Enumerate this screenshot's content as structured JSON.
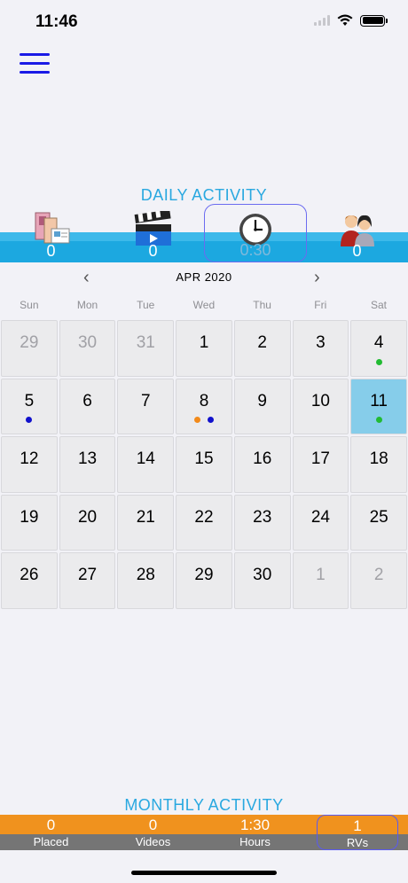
{
  "status": {
    "time": "11:46"
  },
  "daily": {
    "title": "DAILY ACTIVITY",
    "items": [
      {
        "value": "0",
        "icon": "magazines-icon"
      },
      {
        "value": "0",
        "icon": "video-clapper-icon"
      },
      {
        "value": "0:30",
        "icon": "clock-icon"
      },
      {
        "value": "0",
        "icon": "people-icon"
      }
    ]
  },
  "calendar": {
    "month_label": "APR 2020",
    "weekdays": [
      "Sun",
      "Mon",
      "Tue",
      "Wed",
      "Thu",
      "Fri",
      "Sat"
    ],
    "days": [
      {
        "n": "29",
        "muted": true
      },
      {
        "n": "30",
        "muted": true
      },
      {
        "n": "31",
        "muted": true
      },
      {
        "n": "1"
      },
      {
        "n": "2"
      },
      {
        "n": "3"
      },
      {
        "n": "4",
        "dots": [
          "#22bb33"
        ]
      },
      {
        "n": "5",
        "dots": [
          "#1111cc"
        ]
      },
      {
        "n": "6"
      },
      {
        "n": "7"
      },
      {
        "n": "8",
        "dots": [
          "#f28a1a",
          "#1111cc"
        ]
      },
      {
        "n": "9"
      },
      {
        "n": "10"
      },
      {
        "n": "11",
        "today": true,
        "dots": [
          "#22bb33"
        ]
      },
      {
        "n": "12"
      },
      {
        "n": "13"
      },
      {
        "n": "14"
      },
      {
        "n": "15"
      },
      {
        "n": "16"
      },
      {
        "n": "17"
      },
      {
        "n": "18"
      },
      {
        "n": "19"
      },
      {
        "n": "20"
      },
      {
        "n": "21"
      },
      {
        "n": "22"
      },
      {
        "n": "23"
      },
      {
        "n": "24"
      },
      {
        "n": "25"
      },
      {
        "n": "26"
      },
      {
        "n": "27"
      },
      {
        "n": "28"
      },
      {
        "n": "29"
      },
      {
        "n": "30"
      },
      {
        "n": "1",
        "muted": true
      },
      {
        "n": "2",
        "muted": true
      }
    ]
  },
  "monthly": {
    "title": "MONTHLY ACTIVITY",
    "items": [
      {
        "value": "0",
        "label": "Placed"
      },
      {
        "value": "0",
        "label": "Videos"
      },
      {
        "value": "1:30",
        "label": "Hours"
      },
      {
        "value": "1",
        "label": "RVs"
      }
    ]
  },
  "colors": {
    "accent": "#29a8e0",
    "daily_bar": "#1ca8e0",
    "monthly_bar": "#f0921e",
    "today_cell": "#86cdea"
  }
}
